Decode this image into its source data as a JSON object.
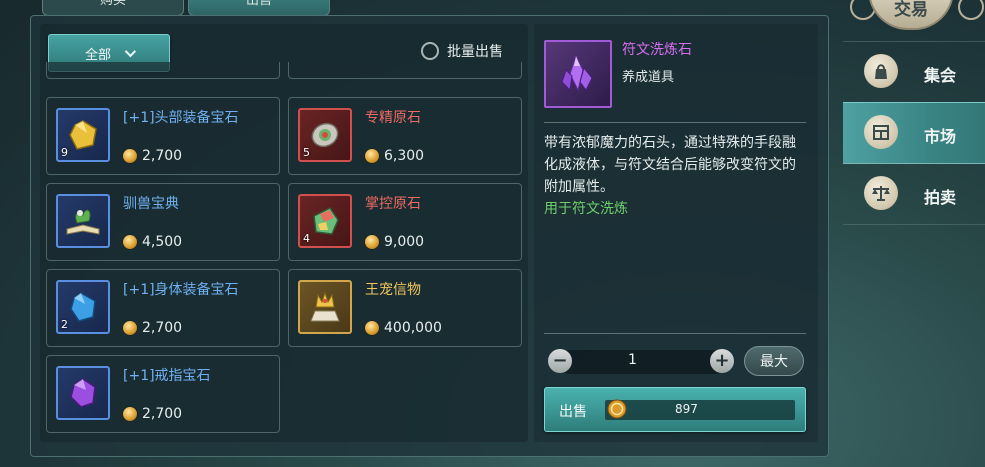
{
  "top_tabs": [
    {
      "label": "购买"
    },
    {
      "label": "出售"
    }
  ],
  "filter": {
    "label": "全部"
  },
  "batch_sell": {
    "label": "批量出售"
  },
  "items": [
    {
      "name": "[+1]头部装备宝石",
      "quantity": "9",
      "price": "2,700",
      "color": "blue",
      "icon": "yellow-gem-icon"
    },
    {
      "name": "专精原石",
      "quantity": "5",
      "price": "6,300",
      "color": "red",
      "icon": "orb-stone-icon"
    },
    {
      "name": "驯兽宝典",
      "quantity": "",
      "price": "4,500",
      "color": "blue",
      "icon": "open-book-icon"
    },
    {
      "name": "掌控原石",
      "quantity": "4",
      "price": "9,000",
      "color": "red",
      "icon": "crystal-stone-icon"
    },
    {
      "name": "[+1]身体装备宝石",
      "quantity": "2",
      "price": "2,700",
      "color": "blue",
      "icon": "blue-gem-icon"
    },
    {
      "name": "王宠信物",
      "quantity": "",
      "price": "400,000",
      "color": "gold",
      "icon": "crown-token-icon"
    },
    {
      "name": "[+1]戒指宝石",
      "quantity": "",
      "price": "2,700",
      "color": "blue",
      "icon": "purple-gem-icon"
    }
  ],
  "detail": {
    "name": "符文洗炼石",
    "type": "养成道具",
    "description": "带有浓郁魔力的石头，通过特殊的手段融化成液体，与符文结合后能够改变符文的附加属性。",
    "usage": "用于符文洗炼",
    "icon": "purple-crystal-icon"
  },
  "quantity": {
    "value": "1",
    "minus": "−",
    "plus": "+",
    "max_label": "最大"
  },
  "sell": {
    "label": "出售",
    "amount": "897"
  },
  "nav": {
    "title": "交易",
    "items": [
      {
        "label": "集会",
        "icon": "bag-icon"
      },
      {
        "label": "市场",
        "icon": "market-icon"
      },
      {
        "label": "拍卖",
        "icon": "scales-icon"
      }
    ],
    "active_index": 1
  },
  "colors": {
    "accent": "#3a9a98",
    "rare_red": "#ef6a61",
    "uncommon_blue": "#6fb1f0",
    "epic_purple": "#d86ef0",
    "usage_green": "#6fd06a"
  }
}
